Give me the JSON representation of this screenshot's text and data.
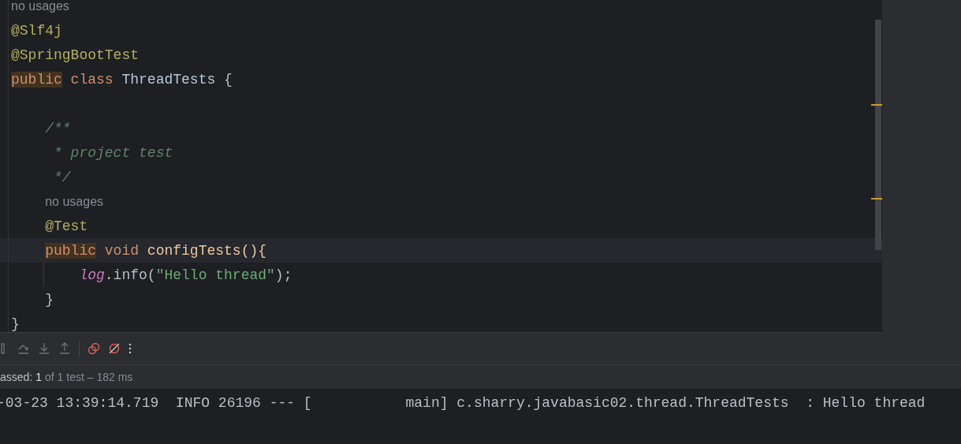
{
  "editor": {
    "lines": [
      {
        "words": [
          [
            {
              "kind": "hint",
              "text": "no usages"
            }
          ]
        ]
      },
      {
        "words": [
          [
            {
              "kind": "annotation",
              "text": "@Slf4j"
            }
          ]
        ]
      },
      {
        "words": [
          [
            {
              "kind": "annotation",
              "text": "@SpringBootTest"
            }
          ]
        ]
      },
      {
        "words": [
          [
            {
              "kind": "keyword",
              "text": "public",
              "highlighted": true
            }
          ],
          [
            {
              "kind": "keyword",
              "text": "class"
            }
          ],
          [
            {
              "kind": "type",
              "text": "ThreadTests"
            }
          ],
          [
            {
              "kind": "plain",
              "text": "{"
            }
          ]
        ],
        "children": [
          {
            "kind": "blank"
          },
          {
            "words": [
              [
                {
                  "kind": "comment",
                  "text": "/**"
                }
              ]
            ]
          },
          {
            "words": [
              [
                {
                  "kind": "comment",
                  "text": " * project test"
                }
              ]
            ]
          },
          {
            "words": [
              [
                {
                  "kind": "comment",
                  "text": " */"
                }
              ]
            ]
          },
          {
            "words": [
              [
                {
                  "kind": "hint",
                  "text": "no usages"
                }
              ]
            ]
          },
          {
            "words": [
              [
                {
                  "kind": "annotation",
                  "text": "@Test"
                }
              ]
            ]
          },
          {
            "current": true,
            "words": [
              [
                {
                  "kind": "keyword",
                  "text": "public",
                  "highlighted": true
                }
              ],
              [
                {
                  "kind": "keyword",
                  "text": "void"
                }
              ],
              [
                {
                  "kind": "method",
                  "text": "configTests(){"
                }
              ]
            ],
            "children": [
              {
                "words": [
                  [
                    {
                      "kind": "field",
                      "text": "log"
                    },
                    {
                      "kind": "plain",
                      "text": ".info("
                    },
                    {
                      "kind": "string",
                      "text": "\"Hello thread\""
                    },
                    {
                      "kind": "plain",
                      "text": ");"
                    }
                  ]
                ]
              }
            ]
          },
          {
            "words": [
              [
                {
                  "kind": "plain",
                  "text": "}"
                }
              ]
            ]
          }
        ]
      },
      {
        "words": [
          [
            {
              "kind": "plain",
              "text": "}"
            }
          ]
        ]
      }
    ]
  },
  "status": {
    "parts": [
      {
        "kind": "label",
        "text": "assed:"
      },
      {
        "kind": "count",
        "text": "1"
      },
      {
        "kind": "detail",
        "text": "of 1 test – 182 ms"
      }
    ]
  },
  "console": {
    "lines": [
      "-03-23 13:39:14.719  INFO 26196 --- [           main] c.sharry.javabasic02.thread.ThreadTests  : Hello thread"
    ]
  }
}
